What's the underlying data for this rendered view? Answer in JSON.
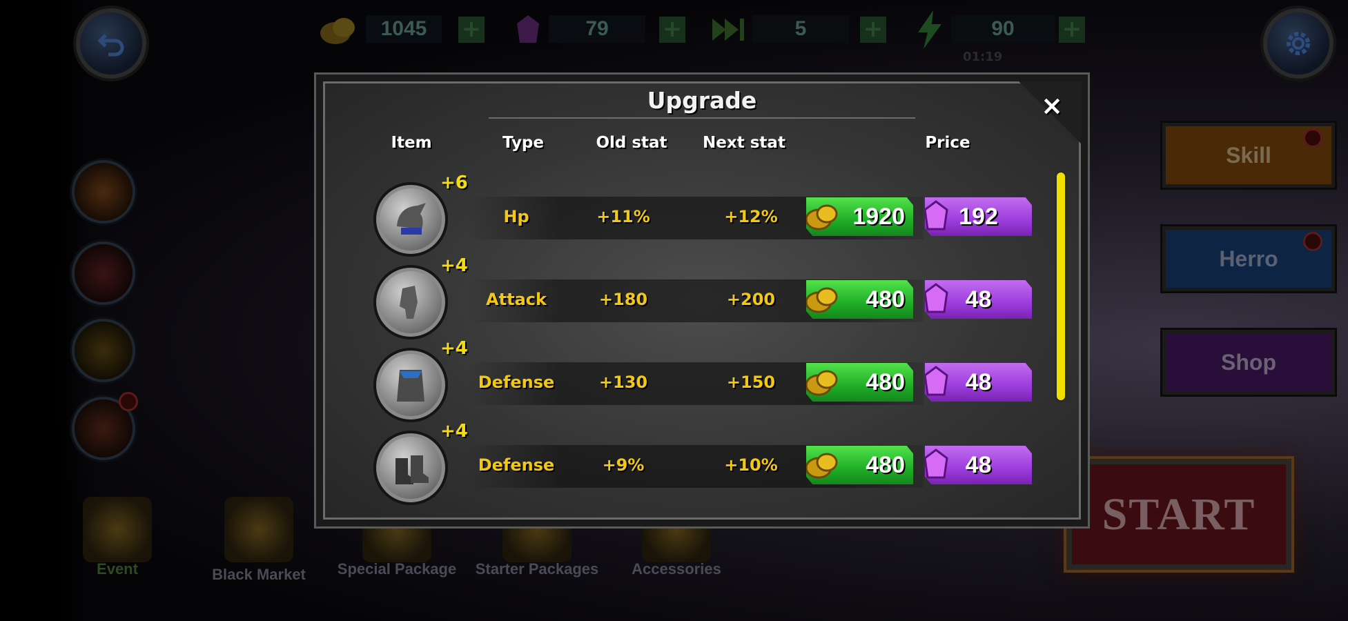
{
  "topbar": {
    "gold": "1045",
    "gems": "79",
    "skips": "5",
    "energy": "90",
    "energy_sub": "01:19"
  },
  "right_menu": {
    "skill": "Skill",
    "hero": "Herro",
    "shop": "Shop",
    "start": "START"
  },
  "bottom_menu": [
    {
      "label": "Event"
    },
    {
      "label": "Black Market"
    },
    {
      "label": "Special Package"
    },
    {
      "label": "Starter Packages"
    },
    {
      "label": "Accessories"
    }
  ],
  "modal": {
    "title": "Upgrade",
    "close": "×",
    "headers": {
      "item": "Item",
      "type": "Type",
      "old_stat": "Old stat",
      "next_stat": "Next stat",
      "price": "Price"
    },
    "rows": [
      {
        "icon": "helmet-icon",
        "level": "+6",
        "type": "Hp",
        "old": "+11%",
        "next": "+12%",
        "gold_price": "1920",
        "gem_price": "192"
      },
      {
        "icon": "gauntlet-icon",
        "level": "+4",
        "type": "Attack",
        "old": "+180",
        "next": "+200",
        "gold_price": "480",
        "gem_price": "48"
      },
      {
        "icon": "armor-icon",
        "level": "+4",
        "type": "Defense",
        "old": "+130",
        "next": "+150",
        "gold_price": "480",
        "gem_price": "48"
      },
      {
        "icon": "boots-icon",
        "level": "+4",
        "type": "Defense",
        "old": "+9%",
        "next": "+10%",
        "gold_price": "480",
        "gem_price": "48"
      }
    ]
  },
  "colors": {
    "stat_yellow": "#f2c812",
    "gold_button": "#1fae27",
    "gem_button": "#9c3ddc",
    "scrollbar": "#f0e000"
  }
}
